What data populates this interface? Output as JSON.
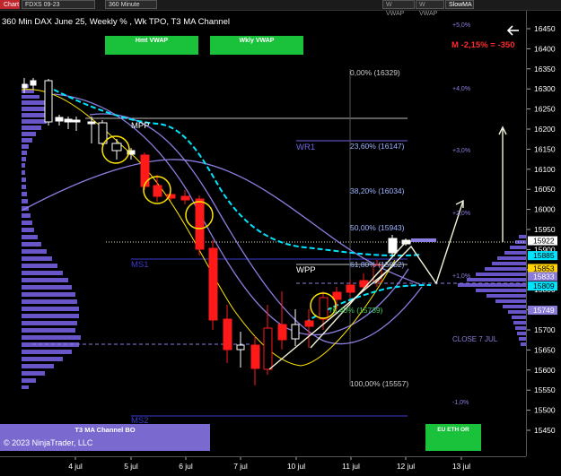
{
  "toolbar": {
    "chart_tab": "Chart",
    "instrument": "FDXS 09-23",
    "interval": "360 Minute",
    "buttons": [
      "W VWAP",
      "W VWAP"
    ],
    "slowma": "SlowMA"
  },
  "title": "360 Min DAX June 25, Weekly % , Wk TPO, T3 MA Channel",
  "hmt_vwap": "Hmt VWAP",
  "wkly_vwap": "Wkly VWAP",
  "m_label": "M -2,15% = -350",
  "fib_labels": [
    "0,00% (16329)",
    "23,60% (16147)",
    "38,20% (16034)",
    "50,00% (15943)",
    "61,80% (15852)",
    "76,40% (15739)",
    "100,00% (15557)"
  ],
  "level_labels": {
    "mpp": "MPP",
    "wr1": "WR1",
    "ms1": "MS1",
    "wpp": "WPP",
    "ms2": "MS2",
    "close": "CLOSE 7 JUL"
  },
  "pct_labels": [
    "+5,0%",
    "+4,0%",
    "+3,0%",
    "+2,0%",
    "+1,0%",
    "-1,0%"
  ],
  "price_ticks": [
    "16450",
    "16400",
    "16350",
    "16300",
    "16250",
    "16200",
    "16150",
    "16100",
    "16050",
    "16000",
    "15950",
    "15900",
    "15850",
    "15800",
    "15750",
    "15700",
    "15650",
    "15600",
    "15550",
    "15500",
    "15450"
  ],
  "price_markers": [
    {
      "text": "15922",
      "bg": "#ffffff",
      "fg": "#000000"
    },
    {
      "text": "15885",
      "bg": "#00e5ff",
      "fg": "#000000"
    },
    {
      "text": "15853",
      "bg": "#ffd400",
      "fg": "#000000"
    },
    {
      "text": "15833",
      "bg": "#8a7bd8",
      "fg": "#ffffff"
    },
    {
      "text": "15809",
      "bg": "#00e5ff",
      "fg": "#000000"
    },
    {
      "text": "15749",
      "bg": "#8a7bd8",
      "fg": "#ffffff"
    }
  ],
  "date_labels": [
    "4 jul",
    "5 jul",
    "6 jul",
    "7 jul",
    "10 jul",
    "11 jul",
    "12 jul",
    "13 jul"
  ],
  "bottom_bar": {
    "t3": "T3 MA Channel BO",
    "eu": "EU ETH OR"
  },
  "copyright": "© 2023 NinjaTrader, LLC",
  "colors": {
    "up": "#ffffff",
    "down": "#ff1a1a",
    "cyan": "#00e5ff",
    "purple": "#8a7bd8",
    "lavender": "#8b7fe0",
    "yellow": "#ffe600",
    "fib": "#9db3ff",
    "green": "#19c23a"
  }
}
